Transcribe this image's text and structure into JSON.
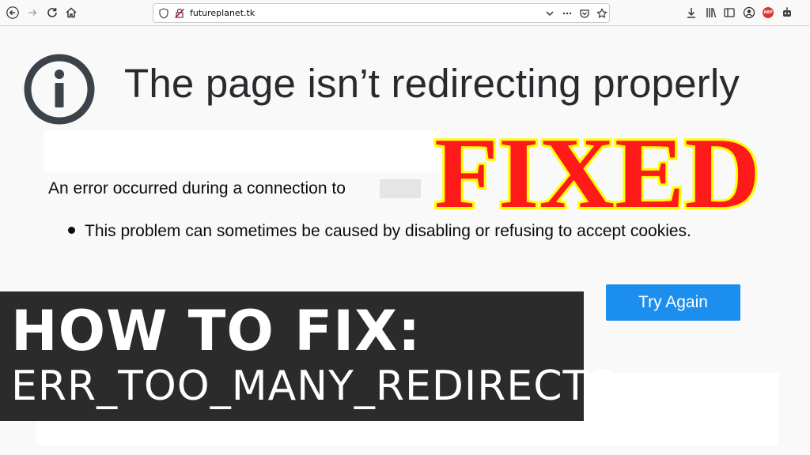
{
  "browser": {
    "url": "futureplanet.tk",
    "icons": [
      "back-icon",
      "forward-icon",
      "reload-icon",
      "home-icon",
      "shield-icon",
      "insecure-lock-icon",
      "chevron-down-icon",
      "more-icon",
      "pocket-icon",
      "star-icon",
      "download-icon",
      "library-icon",
      "sidebar-icon",
      "account-icon",
      "adblock-icon",
      "robot-icon"
    ],
    "adblock_label": "ABP"
  },
  "error_page": {
    "title": "The page isn’t redirecting properly",
    "message": "An error occurred during a connection to",
    "bullet": "This problem can sometimes be caused by disabling or refusing to accept cookies.",
    "try_again": "Try Again"
  },
  "overlay": {
    "fixed": "FIXED",
    "fixed_fill": "#ff1a1a",
    "fixed_stroke": "#ffff00",
    "banner_title": "HOW TO FIX:",
    "banner_sub": "ERR_TOO_MANY_REDIRECTS"
  },
  "colors": {
    "accent": "#1c8fee",
    "banner": "#2b2b2b"
  }
}
